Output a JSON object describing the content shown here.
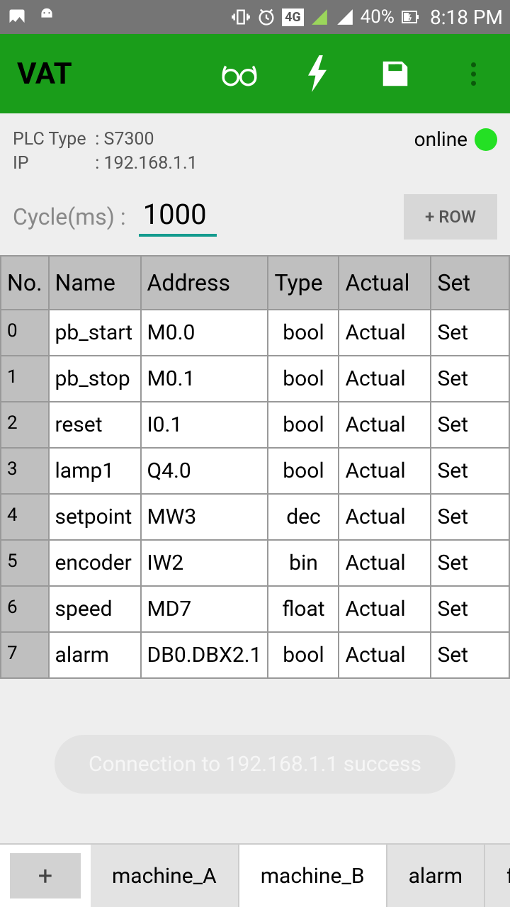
{
  "status_bar": {
    "battery": "40%",
    "time": "8:18 PM"
  },
  "app_bar": {
    "title": "VAT"
  },
  "info": {
    "plc_type_label": "PLC Type",
    "plc_type_value": "S7300",
    "ip_label": "IP",
    "ip_value": "192.168.1.1",
    "online_label": "online",
    "cycle_label": "Cycle(ms) :",
    "cycle_value": "1000",
    "add_row_label": "+ ROW"
  },
  "table": {
    "headers": {
      "no": "No.",
      "name": "Name",
      "address": "Address",
      "type": "Type",
      "actual": "Actual",
      "set": "Set"
    },
    "rows": [
      {
        "no": "0",
        "name": "pb_start",
        "address": "M0.0",
        "type": "bool",
        "actual": "Actual",
        "set": "Set"
      },
      {
        "no": "1",
        "name": "pb_stop",
        "address": "M0.1",
        "type": "bool",
        "actual": "Actual",
        "set": "Set"
      },
      {
        "no": "2",
        "name": "reset",
        "address": "I0.1",
        "type": "bool",
        "actual": "Actual",
        "set": "Set"
      },
      {
        "no": "3",
        "name": "lamp1",
        "address": "Q4.0",
        "type": "bool",
        "actual": "Actual",
        "set": "Set"
      },
      {
        "no": "4",
        "name": "setpoint",
        "address": "MW3",
        "type": "dec",
        "actual": "Actual",
        "set": "Set"
      },
      {
        "no": "5",
        "name": "encoder",
        "address": "IW2",
        "type": "bin",
        "actual": "Actual",
        "set": "Set"
      },
      {
        "no": "6",
        "name": "speed",
        "address": "MD7",
        "type": "float",
        "actual": "Actual",
        "set": "Set"
      },
      {
        "no": "7",
        "name": "alarm",
        "address": "DB0.DBX2.1",
        "type": "bool",
        "actual": "Actual",
        "set": "Set"
      }
    ]
  },
  "toast": {
    "message": "Connection to 192.168.1.1 success"
  },
  "tabs": {
    "plus": "+",
    "items": [
      "machine_A",
      "machine_B",
      "alarm",
      "fee"
    ],
    "active_index": 1
  }
}
